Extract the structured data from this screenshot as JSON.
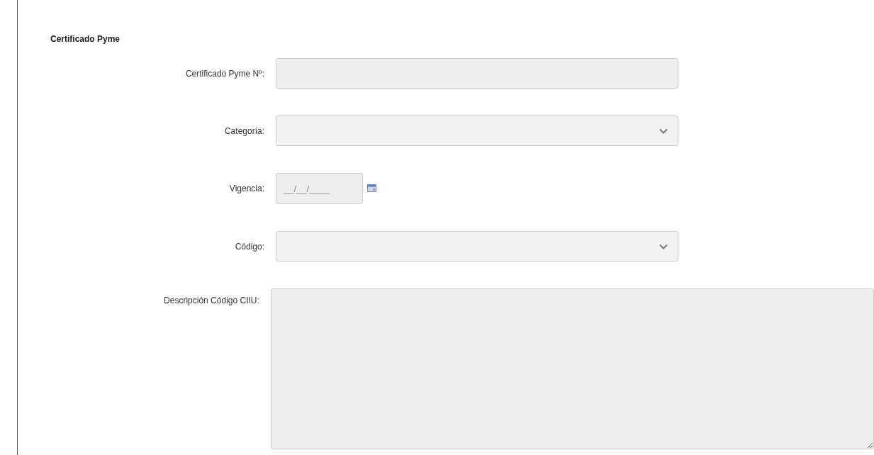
{
  "section": {
    "title": "Certificado Pyme"
  },
  "fields": [
    {
      "kind": "text",
      "label": "Certificado Pyme Nº:"
    },
    {
      "kind": "select",
      "label": "Categoría:"
    },
    {
      "kind": "date",
      "label": "Vigencia:",
      "placeholder": "__/__/____"
    },
    {
      "kind": "select",
      "label": "Código:"
    },
    {
      "kind": "textarea",
      "label": "Descripción Código CIIU:"
    }
  ]
}
